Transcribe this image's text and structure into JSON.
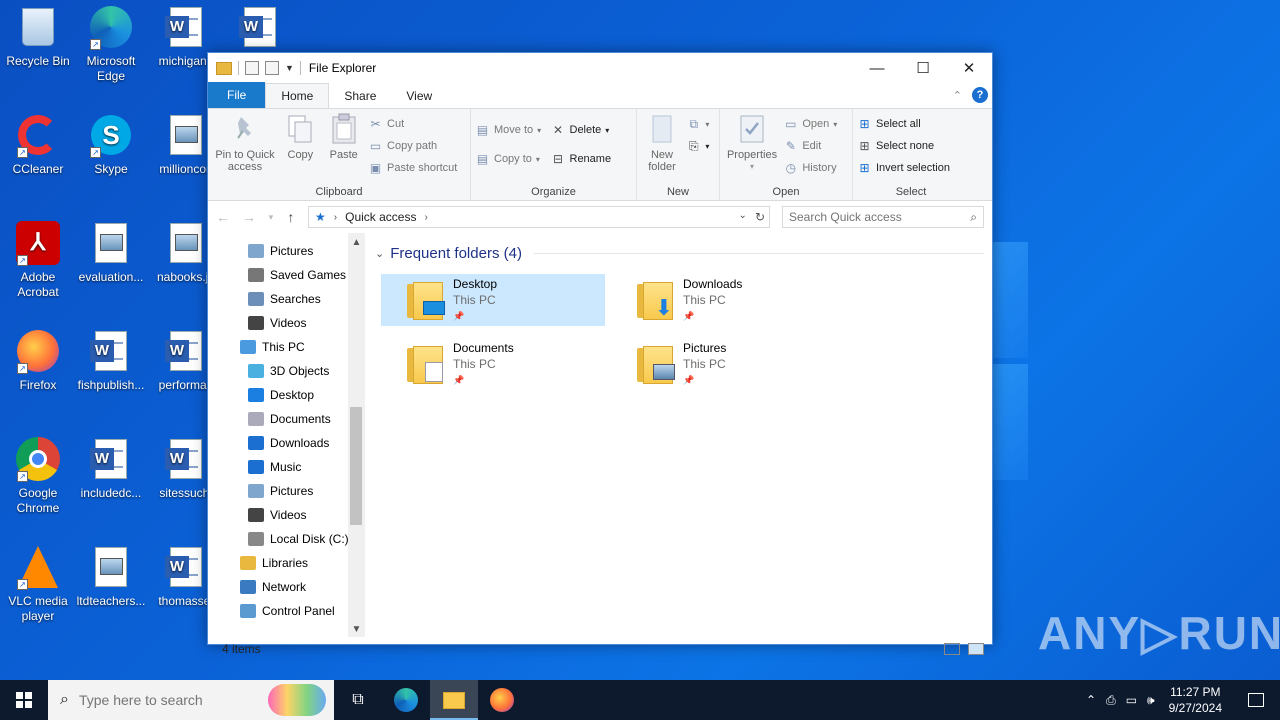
{
  "desktop": {
    "icons": [
      {
        "label": "Recycle Bin",
        "icon": "recycle-bin-icon"
      },
      {
        "label": "Microsoft Edge",
        "icon": "edge-icon"
      },
      {
        "label": "michigane",
        "icon": "word-doc-icon"
      },
      {
        "label": "",
        "icon": "word-doc-icon"
      },
      {
        "label": "CCleaner",
        "icon": "ccleaner-icon"
      },
      {
        "label": "Skype",
        "icon": "skype-icon"
      },
      {
        "label": "millioncon",
        "icon": "image-file-icon"
      },
      {
        "label": "Adobe Acrobat",
        "icon": "acrobat-icon"
      },
      {
        "label": "evaluation...",
        "icon": "image-file-icon"
      },
      {
        "label": "nabooks.jp",
        "icon": "image-file-icon"
      },
      {
        "label": "Firefox",
        "icon": "firefox-icon"
      },
      {
        "label": "fishpublish...",
        "icon": "word-doc-icon"
      },
      {
        "label": "performan",
        "icon": "word-doc-icon"
      },
      {
        "label": "Google Chrome",
        "icon": "chrome-icon"
      },
      {
        "label": "includedc...",
        "icon": "word-doc-icon"
      },
      {
        "label": "sitessuch.",
        "icon": "word-doc-icon"
      },
      {
        "label": "VLC media player",
        "icon": "vlc-icon"
      },
      {
        "label": "ltdteachers...",
        "icon": "image-file-icon"
      },
      {
        "label": "thomasset",
        "icon": "word-doc-icon"
      }
    ],
    "watermark": "ANY▷RUN"
  },
  "window": {
    "title": "File Explorer",
    "controls": {
      "minimize": "—",
      "maximize": "☐",
      "close": "✕"
    },
    "tabs": [
      {
        "label": "File"
      },
      {
        "label": "Home"
      },
      {
        "label": "Share"
      },
      {
        "label": "View"
      }
    ],
    "ribbon": {
      "clipboard": {
        "label": "Clipboard",
        "pin": "Pin to Quick access",
        "copy": "Copy",
        "paste": "Paste",
        "cut": "Cut",
        "copy_path": "Copy path",
        "paste_shortcut": "Paste shortcut"
      },
      "organize": {
        "label": "Organize",
        "move_to": "Move to",
        "copy_to": "Copy to",
        "delete": "Delete",
        "rename": "Rename"
      },
      "new": {
        "label": "New",
        "new_folder": "New folder"
      },
      "open": {
        "label": "Open",
        "properties": "Properties",
        "open": "Open",
        "edit": "Edit",
        "history": "History"
      },
      "select": {
        "label": "Select",
        "select_all": "Select all",
        "select_none": "Select none",
        "invert": "Invert selection"
      }
    },
    "address": {
      "path": "Quick access",
      "search_placeholder": "Search Quick access"
    },
    "nav_items": [
      {
        "label": "Pictures",
        "indent": 1,
        "icon": "pictures-icon"
      },
      {
        "label": "Saved Games",
        "indent": 1,
        "icon": "saved-games-icon"
      },
      {
        "label": "Searches",
        "indent": 1,
        "icon": "searches-icon"
      },
      {
        "label": "Videos",
        "indent": 1,
        "icon": "videos-icon"
      },
      {
        "label": "This PC",
        "indent": 0,
        "icon": "this-pc-icon"
      },
      {
        "label": "3D Objects",
        "indent": 1,
        "icon": "3d-objects-icon"
      },
      {
        "label": "Desktop",
        "indent": 1,
        "icon": "desktop-icon"
      },
      {
        "label": "Documents",
        "indent": 1,
        "icon": "documents-icon"
      },
      {
        "label": "Downloads",
        "indent": 1,
        "icon": "downloads-icon"
      },
      {
        "label": "Music",
        "indent": 1,
        "icon": "music-icon"
      },
      {
        "label": "Pictures",
        "indent": 1,
        "icon": "pictures-icon"
      },
      {
        "label": "Videos",
        "indent": 1,
        "icon": "videos-icon"
      },
      {
        "label": "Local Disk (C:)",
        "indent": 1,
        "icon": "local-disk-icon"
      },
      {
        "label": "Libraries",
        "indent": 0,
        "icon": "libraries-icon"
      },
      {
        "label": "Network",
        "indent": 0,
        "icon": "network-icon"
      },
      {
        "label": "Control Panel",
        "indent": 0,
        "icon": "control-panel-icon"
      }
    ],
    "content": {
      "section_title": "Frequent folders (4)",
      "folders": [
        {
          "name": "Desktop",
          "location": "This PC",
          "badge": "desktop-badge",
          "selected": true
        },
        {
          "name": "Downloads",
          "location": "This PC",
          "badge": "download-arrow-badge",
          "selected": false
        },
        {
          "name": "Documents",
          "location": "This PC",
          "badge": "document-badge",
          "selected": false
        },
        {
          "name": "Pictures",
          "location": "This PC",
          "badge": "picture-badge",
          "selected": false
        }
      ]
    },
    "status": "4 items"
  },
  "taskbar": {
    "search_placeholder": "Type here to search",
    "apps": [
      "task-view-icon",
      "edge-icon",
      "file-explorer-icon",
      "firefox-icon"
    ],
    "active_app": "file-explorer-icon",
    "time": "11:27 PM",
    "date": "9/27/2024"
  },
  "colors": {
    "accent": "#1979ca",
    "selection": "#cce8ff",
    "section_title": "#1e3287",
    "taskbar": "#0d1a2e"
  }
}
